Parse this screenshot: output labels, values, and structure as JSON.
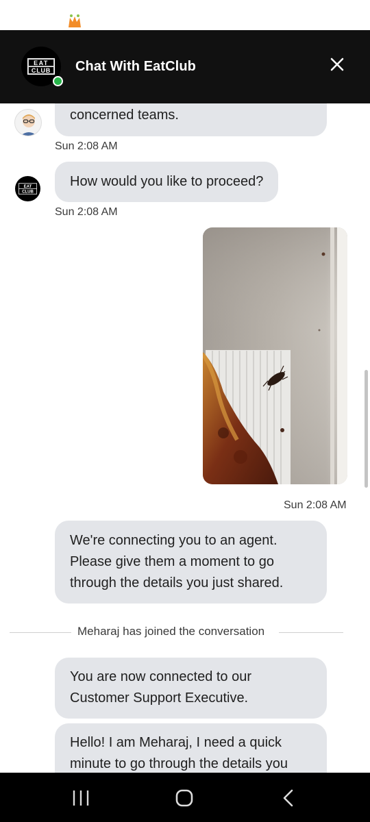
{
  "header": {
    "title": "Chat With EatClub",
    "brand_logo_text_top": "EAT",
    "brand_logo_text_bottom": "CLUB",
    "status": "online"
  },
  "messages": [
    {
      "sender": "user",
      "text": "concerned teams.",
      "time": "Sun 2:08 AM"
    },
    {
      "sender": "bot",
      "text": "How would you like to proceed?",
      "time": "Sun 2:08 AM"
    },
    {
      "sender": "me",
      "type": "image",
      "image_desc_icon": "photo-attachment-icon",
      "time": "Sun 2:08 AM"
    },
    {
      "sender": "bot",
      "lines": [
        "We're connecting you to an agent.",
        "Please give them a moment to go",
        "through the details you just shared."
      ]
    },
    {
      "sender": "system",
      "text": "Meharaj has joined the conversation"
    },
    {
      "sender": "agent",
      "lines": [
        "You are now connected to our",
        "Customer Support Executive."
      ]
    },
    {
      "sender": "agent",
      "lines": [
        "Hello! I am Meharaj, I need a quick",
        "minute to go through the details you"
      ]
    }
  ],
  "navbar": {
    "icons": [
      "recent-apps-icon",
      "home-icon",
      "back-icon"
    ]
  },
  "colors": {
    "header_bg": "#111111",
    "bubble_bg": "#e3e5e9",
    "online": "#27b54a",
    "status_logo": "#f28c28"
  }
}
